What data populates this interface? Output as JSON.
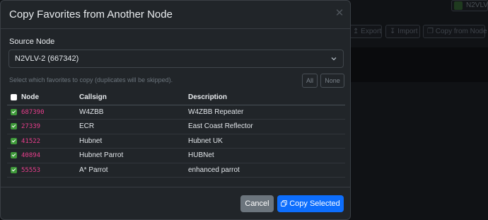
{
  "background": {
    "user_label": "N2VLV",
    "toolbar": {
      "export_label": "Export",
      "import_label": "Import",
      "copy_from_node_label": "Copy from Node"
    }
  },
  "modal": {
    "title": "Copy Favorites from Another Node",
    "source_label": "Source Node",
    "source_value": "N2VLV-2 (667342)",
    "help_text": "Select which favorites to copy (duplicates will be skipped).",
    "all_label": "All",
    "none_label": "None",
    "columns": {
      "node": "Node",
      "callsign": "Callsign",
      "description": "Description"
    },
    "rows": [
      {
        "node": "687390",
        "callsign": "W4ZBB",
        "description": "W4ZBB Repeater",
        "checked": true
      },
      {
        "node": "27339",
        "callsign": "ECR",
        "description": "East Coast Reflector",
        "checked": true
      },
      {
        "node": "41522",
        "callsign": "Hubnet",
        "description": "Hubnet UK",
        "checked": true
      },
      {
        "node": "40894",
        "callsign": "Hubnet Parrot",
        "description": "HUBNet",
        "checked": true
      },
      {
        "node": "55553",
        "callsign": "A* Parrot",
        "description": "enhanced parrot",
        "checked": true
      }
    ],
    "cancel_label": "Cancel",
    "copy_label": "Copy Selected"
  },
  "colors": {
    "accent": "#0d6efd",
    "node_text": "#e83e8c",
    "checkbox": "#3f9a3a",
    "secondary": "#6c757d"
  },
  "icons": {
    "close": "close-icon",
    "chevron": "chevron-down-icon",
    "copy": "copy-icon"
  }
}
